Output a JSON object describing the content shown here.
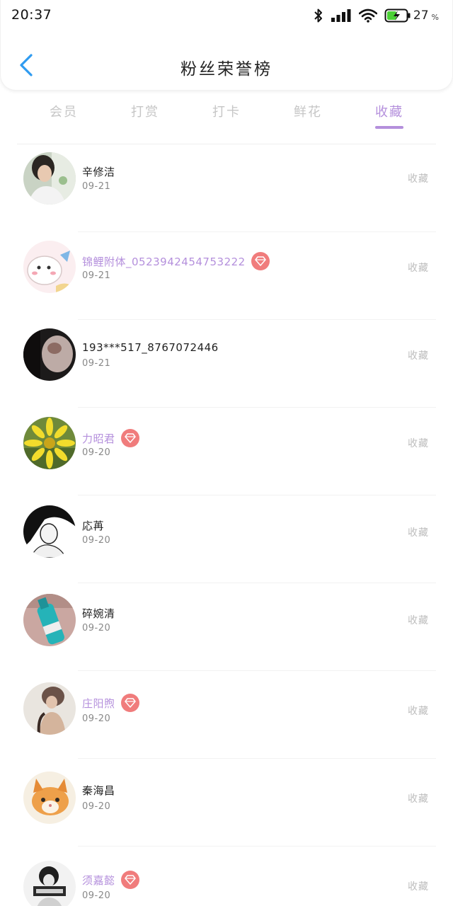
{
  "status_bar": {
    "time": "20:37",
    "battery_percent": "27",
    "battery_unit": "%",
    "icons": [
      "bluetooth-icon",
      "signal-icon",
      "wifi-icon",
      "battery-icon"
    ],
    "battery_level": 0.27,
    "battery_color": "#4cd137"
  },
  "header": {
    "title": "粉丝荣誉榜",
    "back_icon": "chevron-left-icon",
    "back_color": "#2f9bf0"
  },
  "tabs": [
    {
      "label": "会员"
    },
    {
      "label": "打赏"
    },
    {
      "label": "打卡"
    },
    {
      "label": "鲜花"
    },
    {
      "label": "收藏"
    }
  ],
  "active_tab": "收藏",
  "accent_color": "#b48fdc",
  "badge_color": "#f07c7c",
  "fans": [
    {
      "name": "辛修洁",
      "date": "09-21",
      "action": "收藏",
      "vip": false
    },
    {
      "name": "锦鲤附体_0523942454753222",
      "date": "09-21",
      "action": "收藏",
      "vip": true
    },
    {
      "name": "193***517_8767072446",
      "date": "09-21",
      "action": "收藏",
      "vip": false
    },
    {
      "name": "力昭君",
      "date": "09-20",
      "action": "收藏",
      "vip": true
    },
    {
      "name": "応苒",
      "date": "09-20",
      "action": "收藏",
      "vip": false
    },
    {
      "name": "碎婉清",
      "date": "09-20",
      "action": "收藏",
      "vip": false
    },
    {
      "name": "庄阳煦",
      "date": "09-20",
      "action": "收藏",
      "vip": true
    },
    {
      "name": "秦海昌",
      "date": "09-20",
      "action": "收藏",
      "vip": false
    },
    {
      "name": "须嘉懿",
      "date": "09-20",
      "action": "收藏",
      "vip": true
    }
  ]
}
